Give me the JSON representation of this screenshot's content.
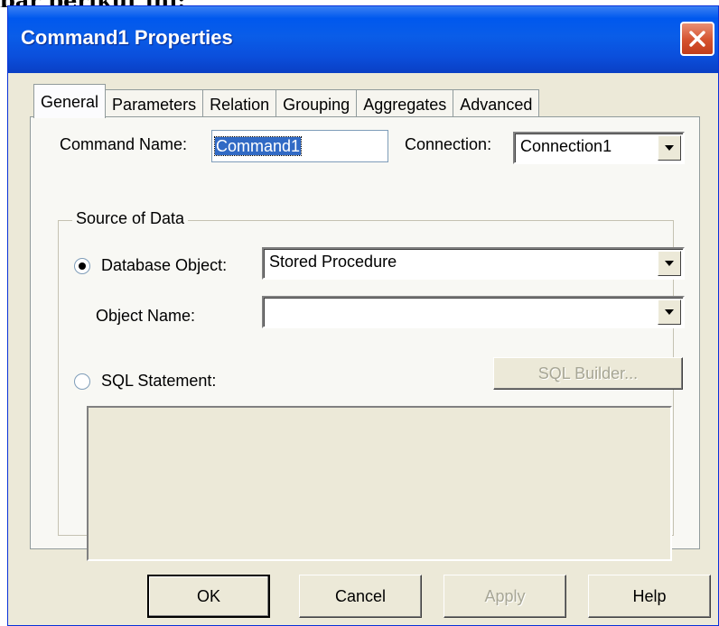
{
  "page_header": {
    "text": "bar berikut ini:"
  },
  "window": {
    "title": "Command1 Properties",
    "close_glyph": "✕"
  },
  "tabs": [
    {
      "label": "General",
      "active": true
    },
    {
      "label": "Parameters",
      "active": false
    },
    {
      "label": "Relation",
      "active": false
    },
    {
      "label": "Grouping",
      "active": false
    },
    {
      "label": "Aggregates",
      "active": false
    },
    {
      "label": "Advanced",
      "active": false
    }
  ],
  "general": {
    "command_name_label": "Command Name:",
    "command_name_value": "Command1",
    "connection_label": "Connection:",
    "connection_value": "Connection1",
    "source_group_label": "Source of Data",
    "database_object_label": "Database Object:",
    "database_object_value": "Stored Procedure",
    "object_name_label": "Object Name:",
    "object_name_value": "",
    "sql_statement_label": "SQL Statement:",
    "sql_builder_label": "SQL Builder...",
    "sql_text": ""
  },
  "buttons": {
    "ok": "OK",
    "cancel": "Cancel",
    "apply": "Apply",
    "help": "Help"
  },
  "colors": {
    "titlebar": "#0a5de8",
    "close": "#d5522e",
    "face": "#ece9d8"
  },
  "icons": {
    "close": "close-icon",
    "dropdown": "chevron-down-icon"
  }
}
